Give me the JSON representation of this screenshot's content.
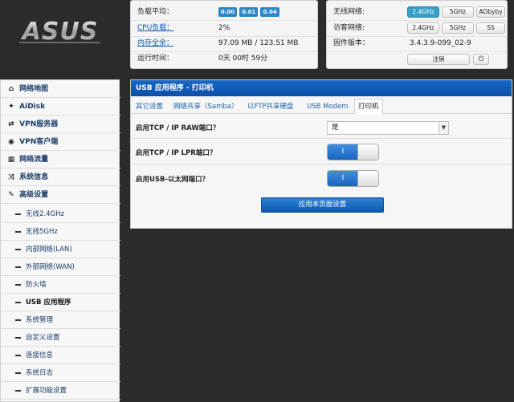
{
  "brand": {
    "logo_text": "ASUS"
  },
  "status": {
    "load_label": "负载平均：",
    "load_values": [
      "0.00",
      "0.01",
      "0.04"
    ],
    "cpu_label": "CPU负载：",
    "cpu_value": "2%",
    "mem_label": "内存全余：",
    "mem_value": "97.09 MB / 123.51 MB",
    "uptime_label": "运行时间：",
    "uptime_value": "0天 00时 59分"
  },
  "wireless": {
    "wifi_label": "无线网络:",
    "wifi_buttons": [
      "2.4GHz",
      "5GHz",
      "ADbyby"
    ],
    "guest_label": "访客网络:",
    "guest_buttons": [
      "2.4GHz",
      "5GHz",
      "SS"
    ],
    "firmware_label": "固件版本：",
    "firmware_value": "3.4.3.9-099_02-9",
    "logout_label": "注销",
    "power_icon": "⏻"
  },
  "sidebar": {
    "main_items": [
      {
        "icon": "⌂",
        "label": "网络地图"
      },
      {
        "icon": "✦",
        "label": "AiDisk"
      },
      {
        "icon": "⇄",
        "label": "VPN服务器"
      },
      {
        "icon": "◉",
        "label": "VPN客户端"
      },
      {
        "icon": "▦",
        "label": "网络流量"
      },
      {
        "icon": "⤨",
        "label": "系统信息"
      },
      {
        "icon": "✎",
        "label": "高级设置"
      }
    ],
    "sub_items": [
      "无线2.4GHz",
      "无线5GHz",
      "内部网络(LAN)",
      "外部网络(WAN)",
      "防火墙",
      "USB 应用程序",
      "系统管理",
      "自定义设置",
      "连接信息",
      "系统日志",
      "扩展功能设置"
    ],
    "active_sub": "USB 应用程序"
  },
  "content": {
    "title": "USB 应用程序 - 打印机",
    "tabs": [
      "其它设置",
      "网络共享（Samba）",
      "以FTP共享硬盘",
      "USB Modem",
      "打印机"
    ],
    "active_tab": "打印机",
    "fields": {
      "raw_label": "启用TCP / IP RAW端口？",
      "raw_value": "是",
      "lpr_label": "启用TCP / IP LPR端口？",
      "lpr_toggle": "I",
      "usb_label": "启用USB-以太网端口？",
      "usb_toggle": "I"
    },
    "apply_label": "应用本页面设置"
  },
  "colors": {
    "accent": "#0b4fa6",
    "badge": "#2a86c6",
    "pill_on": "#36a0c8"
  }
}
